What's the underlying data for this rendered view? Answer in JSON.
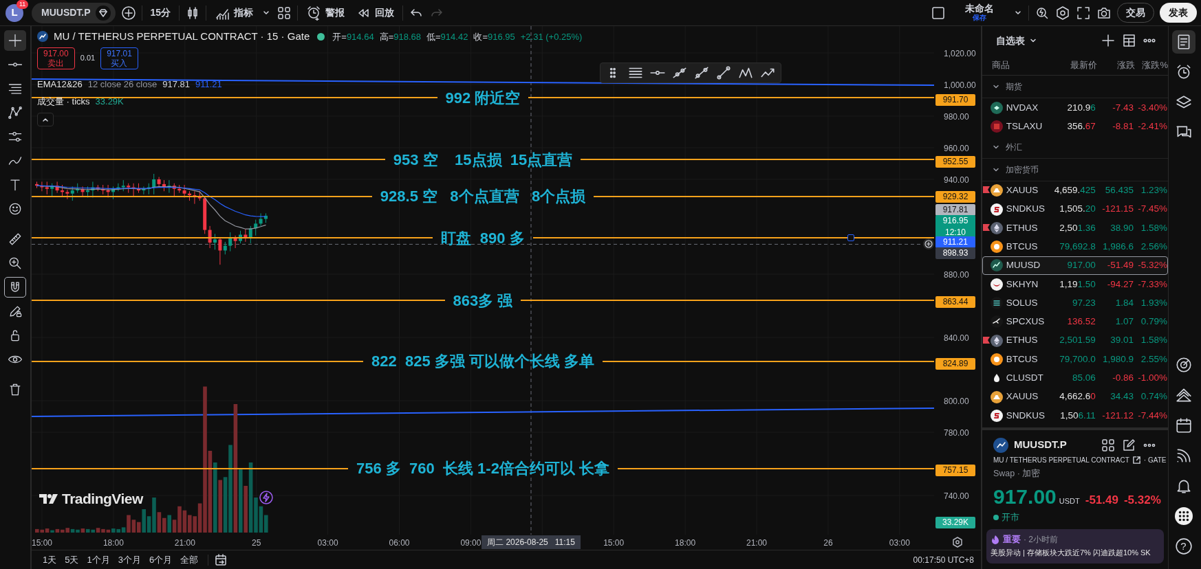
{
  "top_bar": {
    "avatar": "L",
    "badge": "11",
    "symbol": "MUUSDT.P",
    "interval": "15分",
    "indicators": "指标",
    "alerts": "警报",
    "replay": "回放",
    "undo": {
      "disabled": false
    },
    "redo": {
      "disabled": true
    },
    "layout_name": "未命名",
    "layout_save": "保存",
    "trade": "交易",
    "publish": "发表"
  },
  "left_toolbar": {
    "tools": [
      {
        "kind": "crosshair",
        "selected": true
      },
      {
        "kind": "trend-line",
        "selected": false
      },
      {
        "kind": "fib",
        "selected": false
      },
      {
        "kind": "pattern",
        "selected": false
      },
      {
        "kind": "forecast",
        "selected": false
      },
      {
        "kind": "brush",
        "selected": false
      },
      {
        "kind": "text",
        "selected": false
      },
      {
        "kind": "emoji",
        "selected": false
      },
      {
        "kind": "ruler",
        "selected": false
      },
      {
        "kind": "zoom",
        "selected": false
      },
      {
        "kind": "magnet",
        "selected": true
      },
      {
        "kind": "pencil-lock",
        "selected": false
      },
      {
        "kind": "lock",
        "selected": false
      },
      {
        "kind": "eye",
        "selected": false
      },
      {
        "kind": "trash",
        "selected": false
      }
    ]
  },
  "chart": {
    "legend": {
      "title": "MU / TETHERUS PERPETUAL CONTRACT · 15 · Gate",
      "market_open": true,
      "ohlc": [
        {
          "label": "开=",
          "value": "914.64"
        },
        {
          "label": "高=",
          "value": "918.68"
        },
        {
          "label": "低=",
          "value": "914.42"
        },
        {
          "label": "收=",
          "value": "916.95"
        }
      ],
      "change": "+2.31 (+0.25%)"
    },
    "order": {
      "sell_price": "917.00",
      "sell_label": "卖出",
      "spread": "0.01",
      "buy_price": "917.01",
      "buy_label": "买入"
    },
    "indicators": [
      {
        "name": "EMA12&26",
        "params": "12 close 26 close",
        "values": [
          {
            "text": "917.81",
            "color": "#d1d4dc"
          },
          {
            "text": "911.21",
            "color": "#2962ff"
          }
        ]
      },
      {
        "name": "成交量 · ticks",
        "values": [
          {
            "text": "33.29K",
            "color": "#22ab94"
          }
        ]
      }
    ],
    "annotations": [
      "992 附近空",
      "953 空    15点损  15点直营",
      "928.5 空   8个点直营   8个点损",
      "盯盘  890 多",
      "863多 强",
      "822  825 多强 可以做个长线 多单",
      "756 多  760  长线 1-2倍合约可以 长拿"
    ],
    "price_axis": {
      "ticks": [
        "1,020.00",
        "1,000.00",
        "980.00",
        "960.00",
        "940.00",
        "880.00",
        "840.00",
        "800.00",
        "780.00",
        "740.00"
      ],
      "tags": [
        {
          "text": "991.70",
          "color": "#f7a21b"
        },
        {
          "text": "952.55",
          "color": "#f7a21b"
        },
        {
          "text": "929.32",
          "color": "#f7a21b"
        },
        {
          "text": "917.81",
          "color": "#b2b5be"
        },
        {
          "text": "916.95",
          "countdown": "12:10",
          "color": "#089981"
        },
        {
          "text": "911.21",
          "color": "#2962ff"
        },
        {
          "text": "898.93",
          "color": "#363a45"
        },
        {
          "text": "863.44",
          "color": "#f7a21b"
        },
        {
          "text": "824.89",
          "color": "#f7a21b"
        },
        {
          "text": "757.15",
          "color": "#f7a21b"
        },
        {
          "text": "33.29K",
          "color": "#22ab94"
        }
      ]
    },
    "time_axis": {
      "labels": [
        "15:00",
        "18:00",
        "21:00",
        "25",
        "03:00",
        "06:00",
        "09:00",
        "15:00",
        "18:00",
        "21:00",
        "26",
        "03:00"
      ],
      "crosshair_label": "周二 2026-08-25   11:15"
    },
    "logo": "TradingView"
  },
  "bottom_bar": {
    "ranges": [
      "1天",
      "5天",
      "1个月",
      "3个月",
      "6个月",
      "全部"
    ],
    "clock": "00:17:50 UTC+8"
  },
  "watchlist": {
    "title": "自选表",
    "columns": [
      "商品",
      "最新价",
      "涨跌",
      "涨跌%"
    ],
    "sections": [
      {
        "name": "期货",
        "expanded": true,
        "rows": [
          {
            "symbol": "NVDAX",
            "kind": "nvda",
            "flagged": false,
            "selected": false,
            "price_head": "210.9",
            "price_tail": {
              "text": "6",
              "color": "#089981"
            },
            "change": "-7.43",
            "change_pct": "-3.40%",
            "color": "#f23645"
          },
          {
            "symbol": "TSLAXU",
            "kind": "tsla",
            "flagged": false,
            "selected": false,
            "price_head": "356.",
            "price_tail": {
              "text": "67",
              "color": "#f23645"
            },
            "change": "-8.81",
            "change_pct": "-2.41%",
            "color": "#f23645"
          }
        ]
      },
      {
        "name": "外汇",
        "expanded": true
      },
      {
        "name": "加密货币",
        "expanded": true,
        "rows": [
          {
            "symbol": "XAUUS",
            "kind": "gold",
            "flagged": true,
            "selected": false,
            "price_head": "4,659.",
            "price_tail": {
              "text": "425",
              "color": "#089981"
            },
            "change": "56.435",
            "change_pct": "1.23%",
            "color": "#089981"
          },
          {
            "symbol": "SNDKUS",
            "kind": "sandisk",
            "flagged": false,
            "selected": false,
            "price_head": "1,505.",
            "price_tail": {
              "text": "20",
              "color": "#089981"
            },
            "change": "-121.15",
            "change_pct": "-7.45%",
            "color": "#f23645"
          },
          {
            "symbol": "ETHUS",
            "kind": "eth",
            "flagged": true,
            "selected": false,
            "price_head": "2,50",
            "price_tail": {
              "text": "1.36",
              "color": "#089981"
            },
            "change": "38.90",
            "change_pct": "1.58%",
            "color": "#089981"
          },
          {
            "symbol": "BTCUS",
            "kind": "btc",
            "flagged": false,
            "selected": false,
            "price_tail": {
              "text": "79,692.8",
              "color": "#089981"
            },
            "change": "1,986.6",
            "change_pct": "2.56%",
            "color": "#089981"
          },
          {
            "symbol": "MUUSD",
            "kind": "mu",
            "flagged": false,
            "selected": true,
            "price_tail": {
              "text": "917.00",
              "color": "#089981"
            },
            "change": "-51.49",
            "change_pct": "-5.32%",
            "color": "#f23645"
          },
          {
            "symbol": "SKHYN",
            "kind": "hynix",
            "flagged": false,
            "selected": false,
            "price_head": "1,19",
            "price_tail": {
              "text": "1.50",
              "color": "#089981"
            },
            "change": "-94.27",
            "change_pct": "-7.33%",
            "color": "#f23645"
          },
          {
            "symbol": "SOLUS",
            "kind": "sol",
            "flagged": false,
            "selected": false,
            "price_tail": {
              "text": "97.23",
              "color": "#089981"
            },
            "change": "1.84",
            "change_pct": "1.93%",
            "color": "#089981"
          },
          {
            "symbol": "SPCXUS",
            "kind": "spcx",
            "flagged": false,
            "selected": false,
            "price_tail": {
              "text": "136.52",
              "color": "#f23645"
            },
            "change": "1.07",
            "change_pct": "0.79%",
            "color": "#089981"
          },
          {
            "symbol": "ETHUS",
            "kind": "eth",
            "flagged": true,
            "selected": false,
            "price_tail": {
              "text": "2,501.59",
              "color": "#089981"
            },
            "change": "39.01",
            "change_pct": "1.58%",
            "color": "#089981"
          },
          {
            "symbol": "BTCUS",
            "kind": "btc",
            "flagged": false,
            "selected": false,
            "price_tail": {
              "text": "79,700.0",
              "color": "#089981"
            },
            "change": "1,980.9",
            "change_pct": "2.55%",
            "color": "#089981"
          },
          {
            "symbol": "CLUSDT",
            "kind": "oil",
            "flagged": false,
            "selected": false,
            "price_tail": {
              "text": "85.06",
              "color": "#089981"
            },
            "change": "-0.86",
            "change_pct": "-1.00%",
            "color": "#f23645"
          },
          {
            "symbol": "XAUUS",
            "kind": "gold",
            "flagged": false,
            "selected": false,
            "price_head": "4,662.6",
            "price_tail": {
              "text": "0",
              "color": "#f23645"
            },
            "change": "34.43",
            "change_pct": "0.74%",
            "color": "#089981"
          },
          {
            "symbol": "SNDKUS",
            "kind": "sandisk",
            "flagged": false,
            "selected": false,
            "price_head": "1,50",
            "price_tail": {
              "text": "6.11",
              "color": "#089981"
            },
            "change": "-121.12",
            "change_pct": "-7.44%",
            "color": "#f23645"
          }
        ]
      }
    ]
  },
  "symbol_panel": {
    "symbol": "MUUSDT.P",
    "title": "MU / TETHERUS PERPETUAL CONTRACT",
    "exchange": "· GATE",
    "subtitle": "Swap · 加密",
    "price": "917.00",
    "currency": "USDT",
    "change": "-51.49",
    "change_pct": "-5.32%",
    "color": "#f23645",
    "status": "开市",
    "market_open": true,
    "news": {
      "tag": "重要",
      "time": "· 2小时前",
      "headline": "美股异动 | 存储板块大跌近7% 闪迪跌超10% SK"
    }
  },
  "right_bar": {
    "items": [
      {
        "kind": "watchlist",
        "selected": true
      },
      {
        "kind": "alarm",
        "selected": false
      },
      {
        "kind": "layers",
        "selected": false
      },
      {
        "kind": "chat",
        "selected": false
      },
      {
        "kind": "spacer"
      },
      {
        "kind": "target",
        "selected": false
      },
      {
        "kind": "ideas",
        "selected": false
      },
      {
        "kind": "calendar",
        "selected": false
      },
      {
        "kind": "broadcast",
        "selected": false
      },
      {
        "kind": "bell",
        "selected": false
      },
      {
        "kind": "apps",
        "selected": false
      },
      {
        "kind": "help",
        "label": "?",
        "selected": false
      }
    ]
  }
}
